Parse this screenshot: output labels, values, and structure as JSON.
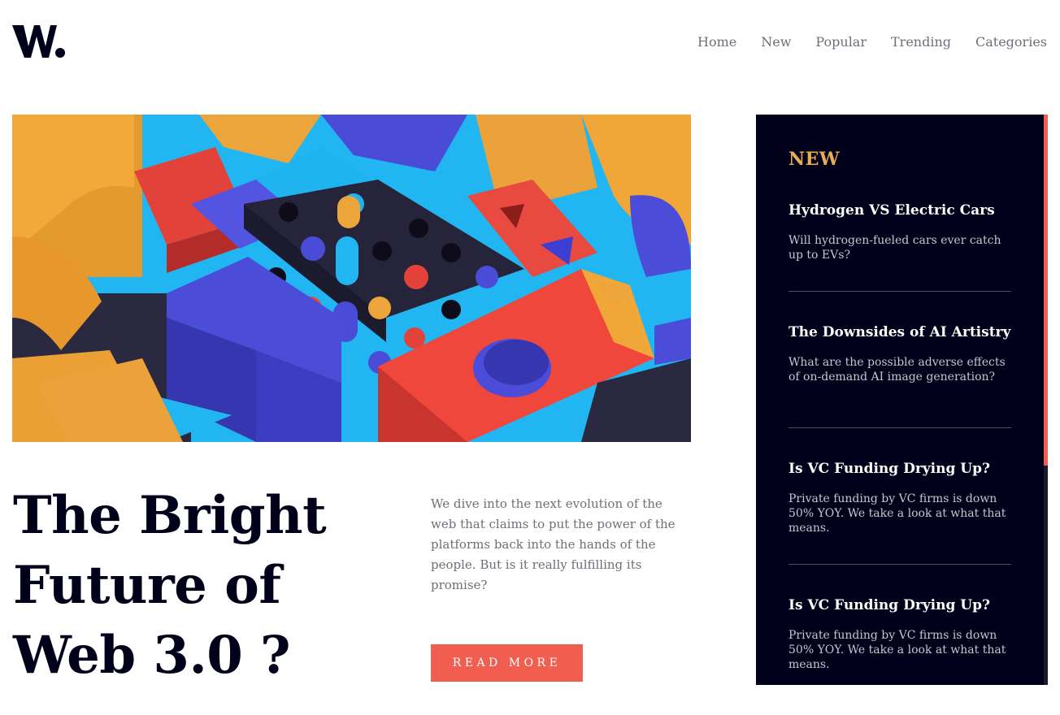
{
  "brand": {
    "logo_text": "W."
  },
  "nav": {
    "items": [
      {
        "label": "Home"
      },
      {
        "label": "New"
      },
      {
        "label": "Popular"
      },
      {
        "label": "Trending"
      },
      {
        "label": "Categories"
      }
    ]
  },
  "hero": {
    "image_icon": "abstract-3d-blocks-image",
    "title": "The Bright Future of Web 3.0 ?",
    "lead": "We dive into the next evolution of the web that claims to put the power of the platforms back into the hands of the people. But is it really fulfilling its promise?",
    "button_label": "READ MORE"
  },
  "sidebar": {
    "heading": "NEW",
    "items": [
      {
        "title": "Hydrogen VS Electric Cars",
        "summary": "Will hydrogen-fueled cars ever catch up to EVs?"
      },
      {
        "title": "The Downsides of AI Artistry",
        "summary": "What are the possible adverse effects of on-demand AI image generation?"
      },
      {
        "title": "Is VC Funding Drying Up?",
        "summary": "Private funding by VC firms is down 50% YOY. We take a look at what that means."
      },
      {
        "title": "Is VC Funding Drying Up?",
        "summary": "Private funding by VC firms is down 50% YOY. We take a look at what that means."
      }
    ]
  },
  "colors": {
    "accent": "#f15e50",
    "sidebar_bg": "#00001a",
    "sidebar_heading": "#e9ab53",
    "text_dark": "#00001a",
    "text_muted": "#6f6f78"
  }
}
